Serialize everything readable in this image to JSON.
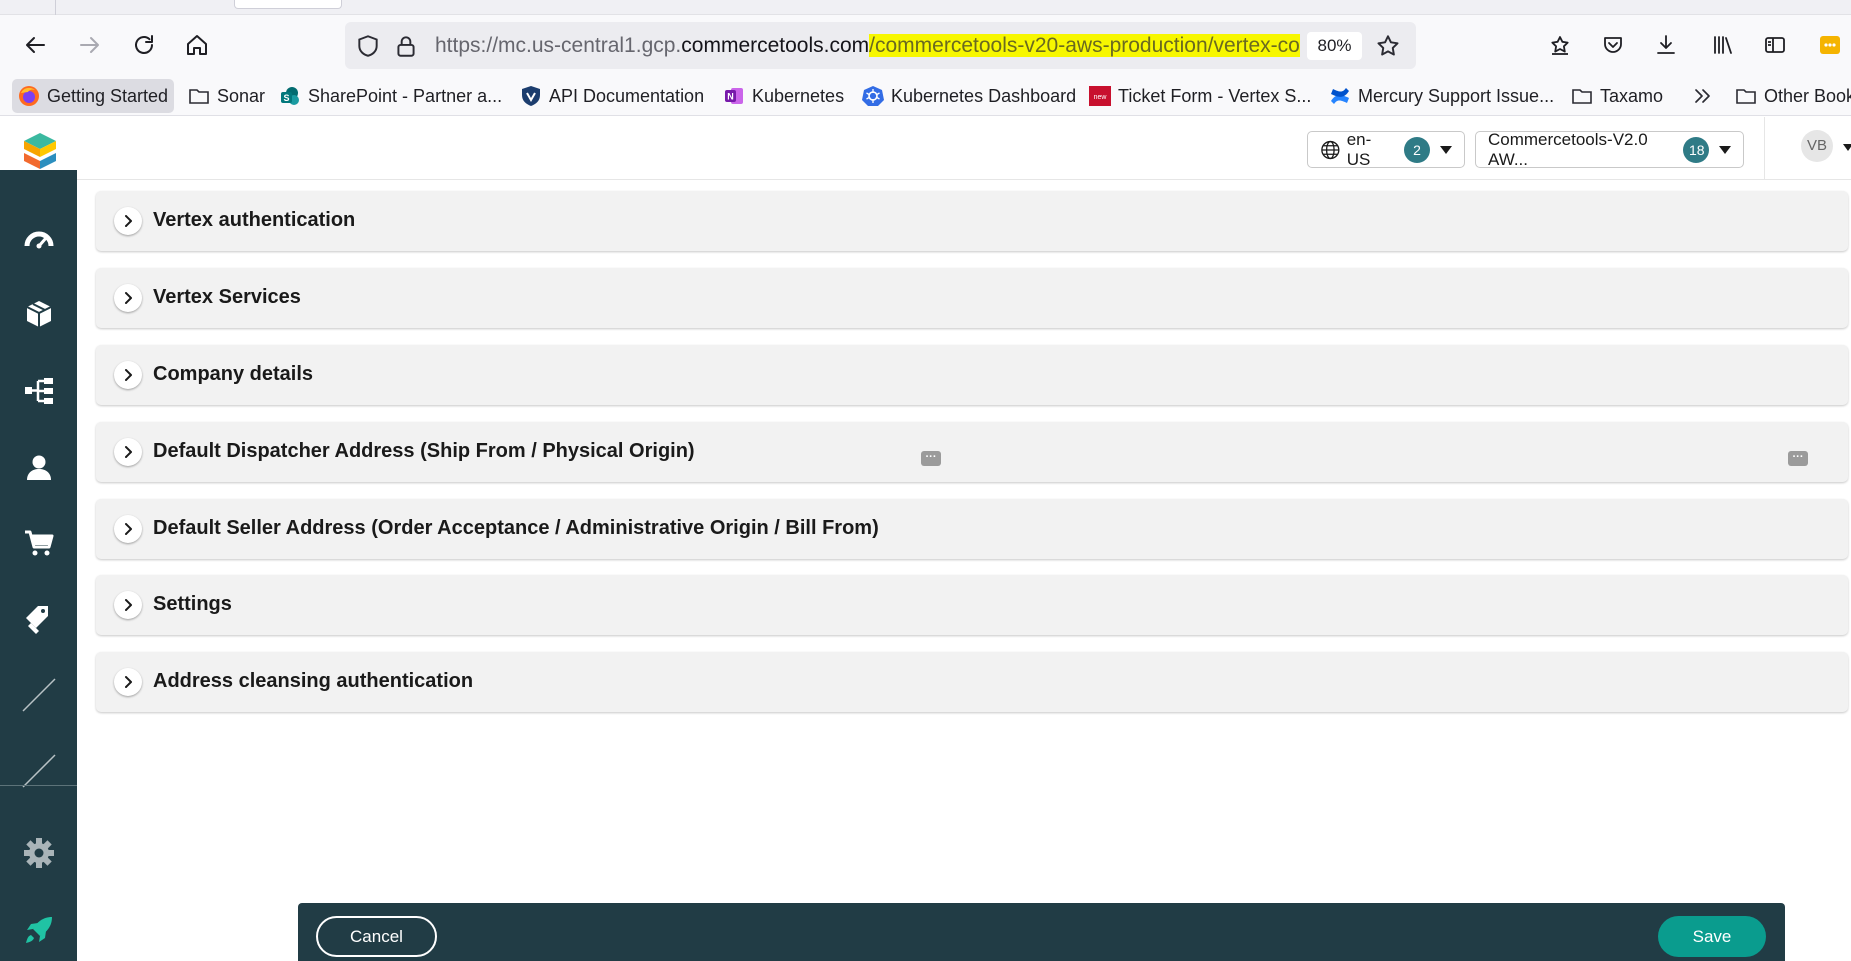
{
  "browser": {
    "url_prefix": "https://mc.us-central1.gcp.",
    "url_domain": "commercetools.com",
    "url_highlight": "/commercetools-v20-aws-production/vertex-co",
    "zoom": "80%",
    "bookmarks": [
      {
        "label": "Getting Started",
        "icon": "firefox-icon"
      },
      {
        "label": "Sonar",
        "icon": "folder-icon"
      },
      {
        "label": "SharePoint - Partner a...",
        "icon": "sharepoint-icon"
      },
      {
        "label": "API Documentation",
        "icon": "shield-icon"
      },
      {
        "label": "Kubernetes",
        "icon": "onenote-icon"
      },
      {
        "label": "Kubernetes Dashboard",
        "icon": "kubernetes-icon"
      },
      {
        "label": "Ticket Form - Vertex S...",
        "icon": "servicenow-icon"
      },
      {
        "label": "Mercury Support Issue...",
        "icon": "confluence-icon"
      },
      {
        "label": "Taxamo",
        "icon": "folder-icon"
      },
      {
        "label": "Other Book",
        "icon": "folder-icon"
      }
    ]
  },
  "header": {
    "locale": "en-US",
    "locale_count": "2",
    "project": "Commercetools-V2.0 AW...",
    "project_count": "18",
    "avatar_initials": "VB"
  },
  "sidebar": {
    "items": [
      {
        "name": "dashboard-icon"
      },
      {
        "name": "products-icon"
      },
      {
        "name": "categories-icon"
      },
      {
        "name": "customers-icon"
      },
      {
        "name": "orders-icon"
      },
      {
        "name": "discounts-icon"
      },
      {
        "name": "custom-app-icon"
      },
      {
        "name": "custom-app-icon"
      },
      {
        "name": "settings-icon"
      },
      {
        "name": "rocket-icon"
      }
    ]
  },
  "sections": [
    {
      "title": "Vertex authentication"
    },
    {
      "title": "Vertex Services"
    },
    {
      "title": "Company details"
    },
    {
      "title": "Default Dispatcher Address (Ship From / Physical Origin)"
    },
    {
      "title": "Default Seller Address (Order Acceptance / Administrative Origin / Bill From)"
    },
    {
      "title": "Settings"
    },
    {
      "title": "Address cleansing authentication"
    }
  ],
  "footer": {
    "cancel_label": "Cancel",
    "save_label": "Save"
  },
  "colors": {
    "sidebar": "#213c45",
    "accent": "#0a9c8e",
    "badge": "#2f7b86",
    "url_highlight": "#f7f700"
  }
}
